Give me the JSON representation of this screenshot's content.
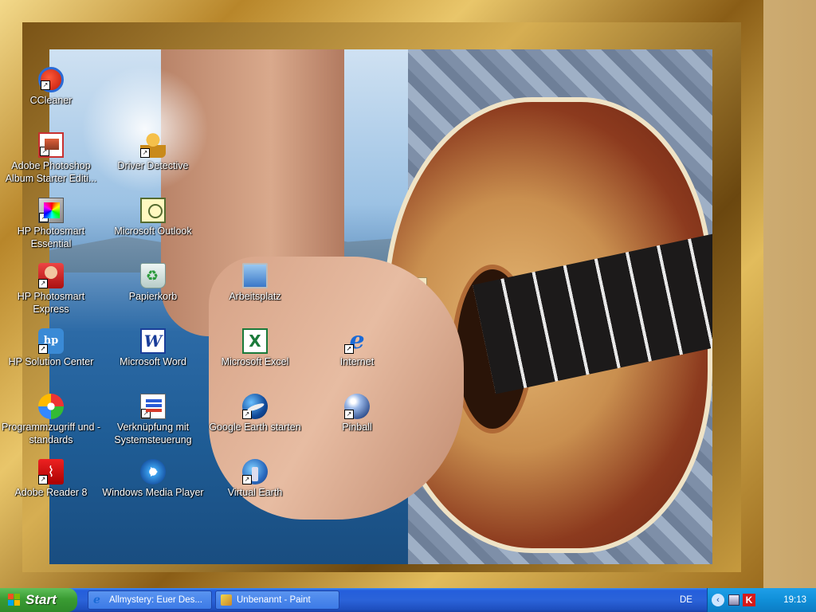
{
  "desktop": {
    "icons": [
      {
        "label": "CCleaner"
      },
      {
        "label": "Adobe Photoshop Album Starter Editi..."
      },
      {
        "label": "HP Photosmart Essential"
      },
      {
        "label": "HP Photosmart Express"
      },
      {
        "label": "HP Solution Center"
      },
      {
        "label": "Programmzugriff und -standards"
      },
      {
        "label": "Adobe Reader 8"
      },
      {
        "label": "Driver Detective"
      },
      {
        "label": "Microsoft Outlook"
      },
      {
        "label": "Papierkorb"
      },
      {
        "label": "Microsoft Word"
      },
      {
        "label": "Verknüpfung mit Systemsteuerung"
      },
      {
        "label": "Windows Media Player"
      },
      {
        "label": "Arbeitsplatz"
      },
      {
        "label": "Microsoft Excel"
      },
      {
        "label": "Google Earth starten"
      },
      {
        "label": "Virtual Earth"
      },
      {
        "label": "Internet"
      },
      {
        "label": "Pinball"
      }
    ]
  },
  "taskbar": {
    "start_label": "Start",
    "tasks": [
      {
        "label": "Allmystery: Euer Des..."
      },
      {
        "label": "Unbenannt - Paint"
      }
    ],
    "language": "DE",
    "clock": "19:13"
  }
}
